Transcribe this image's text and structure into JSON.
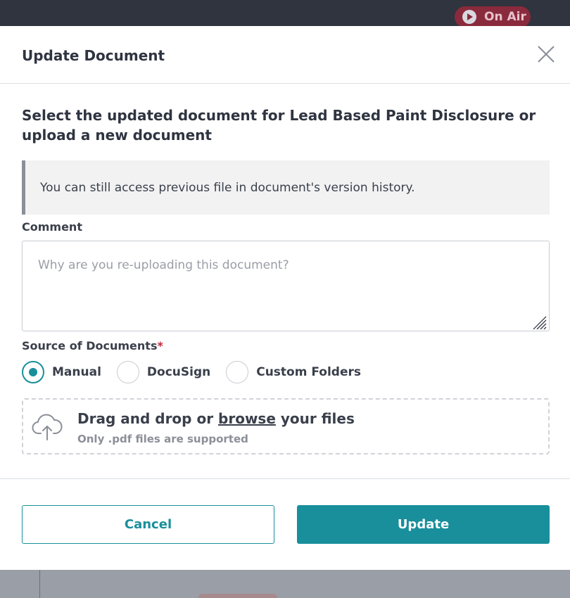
{
  "topbar": {
    "on_air_label": "On Air"
  },
  "modal": {
    "title": "Update Document",
    "heading": "Select the updated document for Lead Based Paint Disclosure or upload a new document",
    "notice": "You can still access previous file in document's version history.",
    "comment": {
      "label": "Comment",
      "placeholder": "Why are you re-uploading this document?",
      "value": ""
    },
    "source": {
      "label": "Source of Documents",
      "required_mark": "*",
      "options": [
        {
          "label": "Manual",
          "selected": true
        },
        {
          "label": "DocuSign",
          "selected": false
        },
        {
          "label": "Custom Folders",
          "selected": false
        }
      ]
    },
    "dropzone": {
      "text_before": "Drag and drop or ",
      "browse_label": "browse",
      "text_after": " your files",
      "hint": "Only .pdf files are supported"
    },
    "buttons": {
      "cancel": "Cancel",
      "update": "Update"
    }
  },
  "colors": {
    "accent": "#188f9b",
    "on_air_bg": "#8a2a3d",
    "required": "#c0263a"
  }
}
